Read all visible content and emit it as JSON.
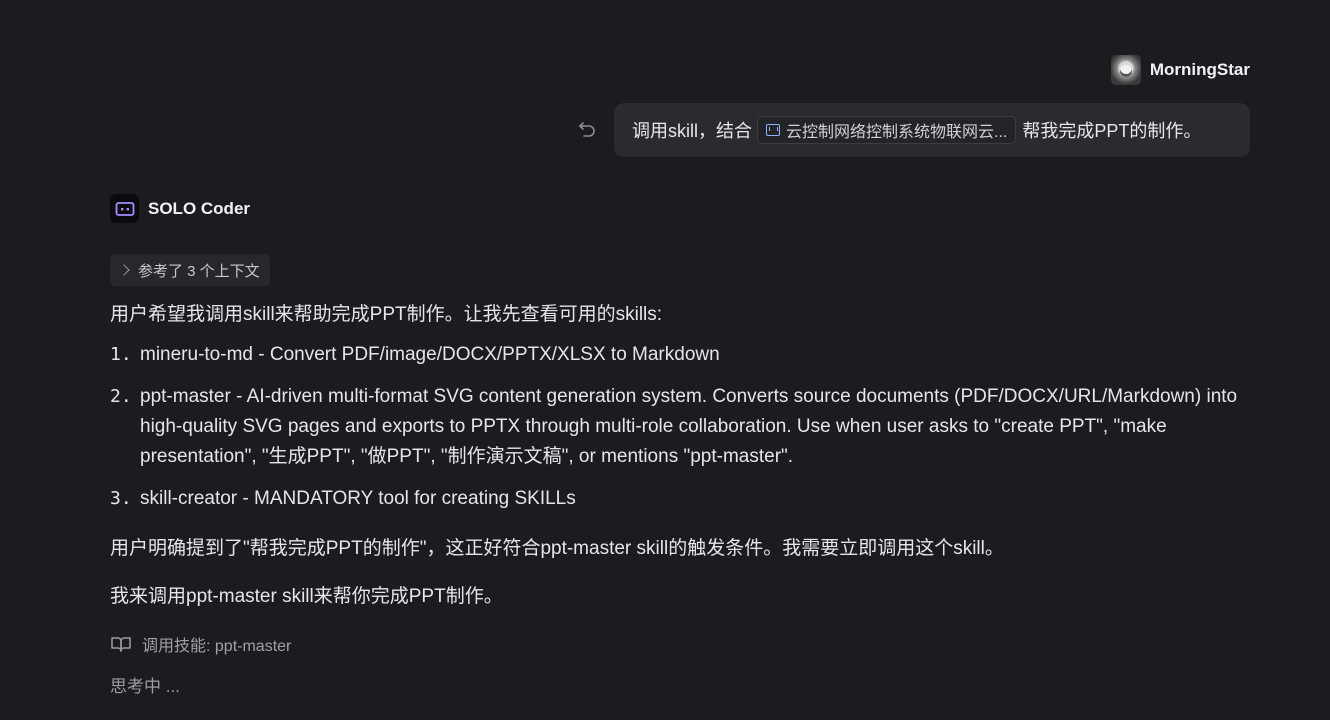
{
  "user": {
    "name": "MorningStar",
    "message_before": "调用skill，结合",
    "file_chip": "云控制网络控制系统物联网云...",
    "message_after": "帮我完成PPT的制作。"
  },
  "assistant": {
    "name": "SOLO Coder",
    "context_label": "参考了 3 个上下文",
    "intro": "用户希望我调用skill来帮助完成PPT制作。让我先查看可用的skills:",
    "skills": [
      {
        "num": "1.",
        "text": "mineru-to-md - Convert PDF/image/DOCX/PPTX/XLSX to Markdown"
      },
      {
        "num": "2.",
        "text": "ppt-master - AI-driven multi-format SVG content generation system. Converts source documents (PDF/DOCX/URL/Markdown) into high-quality SVG pages and exports to PPTX through multi-role collaboration. Use when user asks to \"create PPT\", \"make presentation\", \"生成PPT\", \"做PPT\", \"制作演示文稿\", or mentions \"ppt-master\"."
      },
      {
        "num": "3.",
        "text": "skill-creator - MANDATORY tool for creating SKILLs"
      }
    ],
    "para2": "用户明确提到了\"帮我完成PPT的制作\"，这正好符合ppt-master skill的触发条件。我需要立即调用这个skill。",
    "para3": "我来调用ppt-master skill来帮你完成PPT制作。",
    "skill_call": "调用技能: ppt-master",
    "status": "思考中 ..."
  },
  "icons": {
    "undo": "undo-icon",
    "file": "markdown-file-icon",
    "bot": "bot-icon",
    "chevron": "chevron-right-icon",
    "book": "book-icon"
  }
}
